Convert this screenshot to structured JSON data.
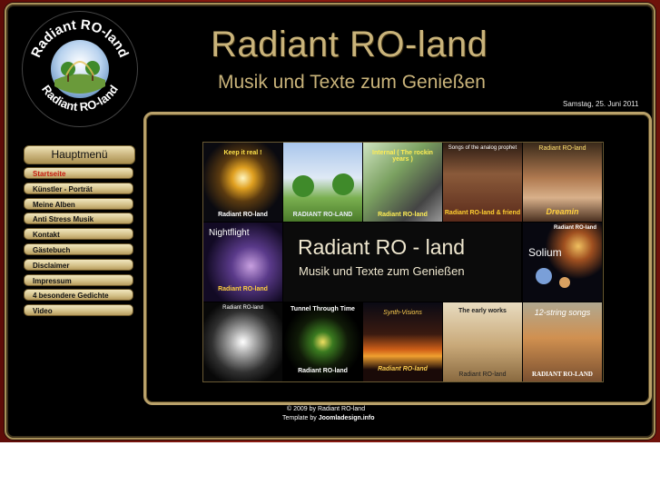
{
  "logo": {
    "text_top": "Radiant RO-land",
    "text_bottom": "Radiant RO-land"
  },
  "header": {
    "title": "Radiant RO-land",
    "subtitle": "Musik und Texte zum Genießen",
    "date": "Samstag, 25. Juni 2011"
  },
  "menu": {
    "header": "Hauptmenü",
    "items": [
      {
        "label": "Startseite",
        "active": true
      },
      {
        "label": "Künstler - Porträt"
      },
      {
        "label": "Meine Alben"
      },
      {
        "label": "Anti Stress Musik"
      },
      {
        "label": "Kontakt"
      },
      {
        "label": "Gästebuch"
      },
      {
        "label": "Disclaimer"
      },
      {
        "label": "Impressum"
      },
      {
        "label": "4 besondere Gedichte"
      },
      {
        "label": "Video"
      }
    ]
  },
  "collage": {
    "banner_title": "Radiant RO - land",
    "banner_subtitle": "Musik und Texte zum Genießen",
    "tiles": [
      {
        "top": "Keep it real !",
        "bottom": "Radiant RO-land"
      },
      {
        "top": "",
        "bottom": "RADIANT RO-LAND"
      },
      {
        "top": "Internal ( The rockin years )",
        "bottom": "Radiant RO-land"
      },
      {
        "top": "Songs of the analog prophet",
        "bottom": "Radiant RO-land & friend"
      },
      {
        "top": "Radiant RO-land",
        "bottom": "Dreamin"
      },
      {
        "top": "Nightflight",
        "bottom": "Radiant RO-land"
      },
      {
        "top": "Radiant RO-land",
        "bottom": "Solium"
      },
      {
        "top": "Radiant RO-land",
        "bottom": ""
      },
      {
        "top": "Tunnel Through Time",
        "bottom": "Radiant RO-land"
      },
      {
        "top": "Synth-Visions",
        "bottom": "Radiant RO-land"
      },
      {
        "top": "The early works",
        "bottom": "Radiant RO-land"
      },
      {
        "top": "12-string songs",
        "bottom": "RADIANT RO-LAND"
      }
    ]
  },
  "footer": {
    "copyright": "© 2009 by Radiant RO-land",
    "template_prefix": "Template by ",
    "template_link": "Joomladesign.info"
  },
  "colors": {
    "gold": "#c9b37a",
    "frame_red": "#8a1a10",
    "active_menu": "#c61d10"
  }
}
